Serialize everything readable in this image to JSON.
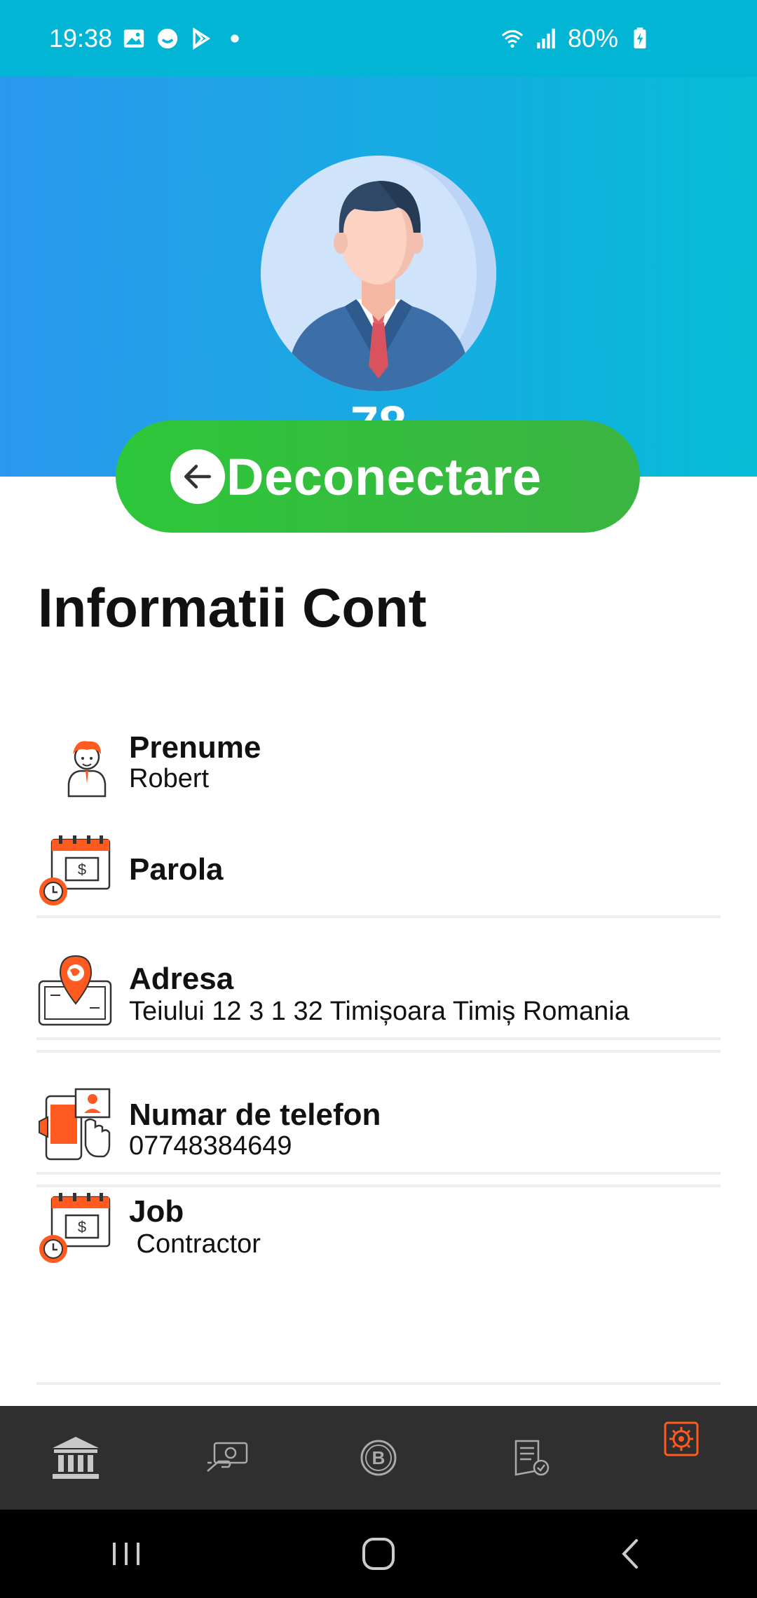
{
  "status_bar": {
    "time": "19:38",
    "battery": "80%",
    "icons": [
      "gallery-icon",
      "chat-icon",
      "play-store-icon",
      "wifi-icon",
      "signal-icon",
      "battery-icon"
    ]
  },
  "header": {
    "user_number": "78",
    "logout_label": "Deconectare"
  },
  "section_title": "Informatii Cont",
  "fields": [
    {
      "label": "Prenume",
      "value": "Robert",
      "icon": "person-icon"
    },
    {
      "label": "Parola",
      "value": "",
      "icon": "calendar-dollar-icon"
    },
    {
      "label": "Adresa",
      "value": "Teiului 12 3 1 32 Timișoara Timiș Romania",
      "icon": "location-map-icon"
    },
    {
      "label": "Numar de telefon",
      "value": "07748384649",
      "icon": "phone-contact-icon"
    },
    {
      "label": "Job",
      "value": " Contractor",
      "icon": "calendar-dollar-icon"
    }
  ],
  "bottom_nav": {
    "items": [
      "bank-icon",
      "money-transfer-icon",
      "bitcoin-icon",
      "receipt-icon",
      "settings-icon"
    ],
    "active": "settings-icon"
  },
  "colors": {
    "status_bar": "#03b5d4",
    "header_start": "#2b97ee",
    "header_end": "#06bcd6",
    "logout_button": "#35bf3d",
    "accent_icon": "#ff5a1f",
    "nav_background": "#2f2f2f"
  }
}
